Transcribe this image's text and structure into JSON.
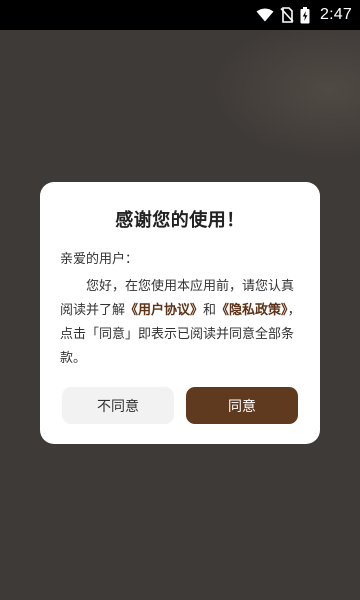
{
  "status_bar": {
    "time": "2:47",
    "icons": [
      "wifi-icon",
      "no-sim-icon",
      "battery-charging-icon"
    ]
  },
  "dialog": {
    "title": "感谢您的使用！",
    "greeting": "亲爱的用户：",
    "body": {
      "part1": "您好，在您使用本应用前，请您认真阅读并了解",
      "user_agreement_link": "《用户协议》",
      "part2": "和",
      "privacy_policy_link": "《隐私政策》",
      "part3": "，点击「同意」即表示已阅读并同意全部条款。"
    },
    "disagree_label": "不同意",
    "agree_label": "同意"
  },
  "colors": {
    "overlay": "#3e3a37",
    "accent": "#603a1e",
    "link": "#5e3216",
    "secondary_button": "#f2f2f2"
  }
}
